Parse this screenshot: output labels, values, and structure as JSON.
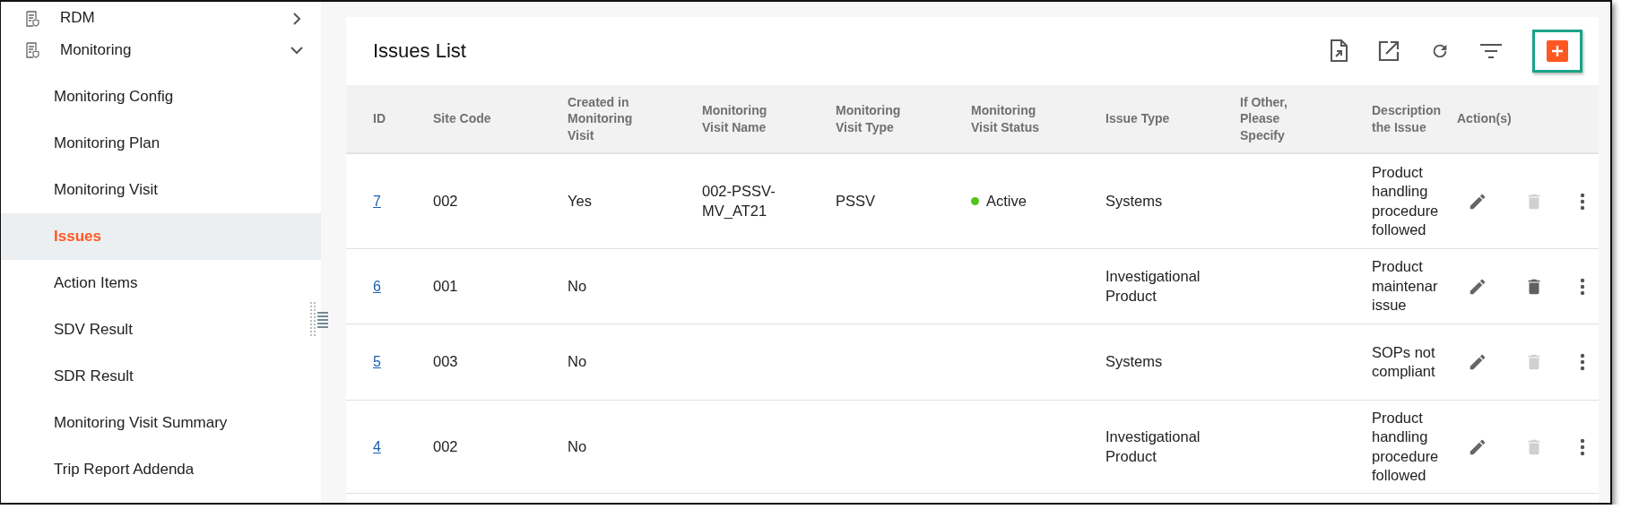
{
  "sidebar": {
    "groups": [
      {
        "label": "RDM",
        "expanded": false
      },
      {
        "label": "Monitoring",
        "expanded": true,
        "children": [
          {
            "label": "Monitoring Config",
            "selected": false
          },
          {
            "label": "Monitoring Plan",
            "selected": false
          },
          {
            "label": "Monitoring Visit",
            "selected": false
          },
          {
            "label": "Issues",
            "selected": true
          },
          {
            "label": "Action Items",
            "selected": false
          },
          {
            "label": "SDV Result",
            "selected": false
          },
          {
            "label": "SDR Result",
            "selected": false
          },
          {
            "label": "Monitoring Visit Summary",
            "selected": false
          },
          {
            "label": "Trip Report Addenda",
            "selected": false
          }
        ]
      }
    ]
  },
  "card": {
    "title": "Issues List",
    "add_button": {
      "highlighted": true
    }
  },
  "table": {
    "columns": [
      "ID",
      "Site Code",
      "Created in Monitoring Visit",
      "Monitoring Visit Name",
      "Monitoring Visit Type",
      "Monitoring Visit Status",
      "Issue Type",
      "If Other, Please Specify",
      "Description the Issue",
      "Action(s)"
    ],
    "rows": [
      {
        "id": "7",
        "site_code": "002",
        "created_in_visit": "Yes",
        "visit_name": "002-PSSV-MV_AT21",
        "visit_type": "PSSV",
        "visit_status": {
          "label": "Active",
          "color": "#52c41a"
        },
        "issue_type": "Systems",
        "description": "Product handling procedure followed",
        "delete_disabled": true
      },
      {
        "id": "6",
        "site_code": "001",
        "created_in_visit": "No",
        "issue_type": "Investigational Product",
        "description": "Product maintenar issue",
        "delete_disabled": false
      },
      {
        "id": "5",
        "site_code": "003",
        "created_in_visit": "No",
        "issue_type": "Systems",
        "description": "SOPs not compliant",
        "delete_disabled": true
      },
      {
        "id": "4",
        "site_code": "002",
        "created_in_visit": "No",
        "issue_type": "Investigational Product",
        "description": "Product handling procedure followed",
        "delete_disabled": true
      }
    ]
  }
}
